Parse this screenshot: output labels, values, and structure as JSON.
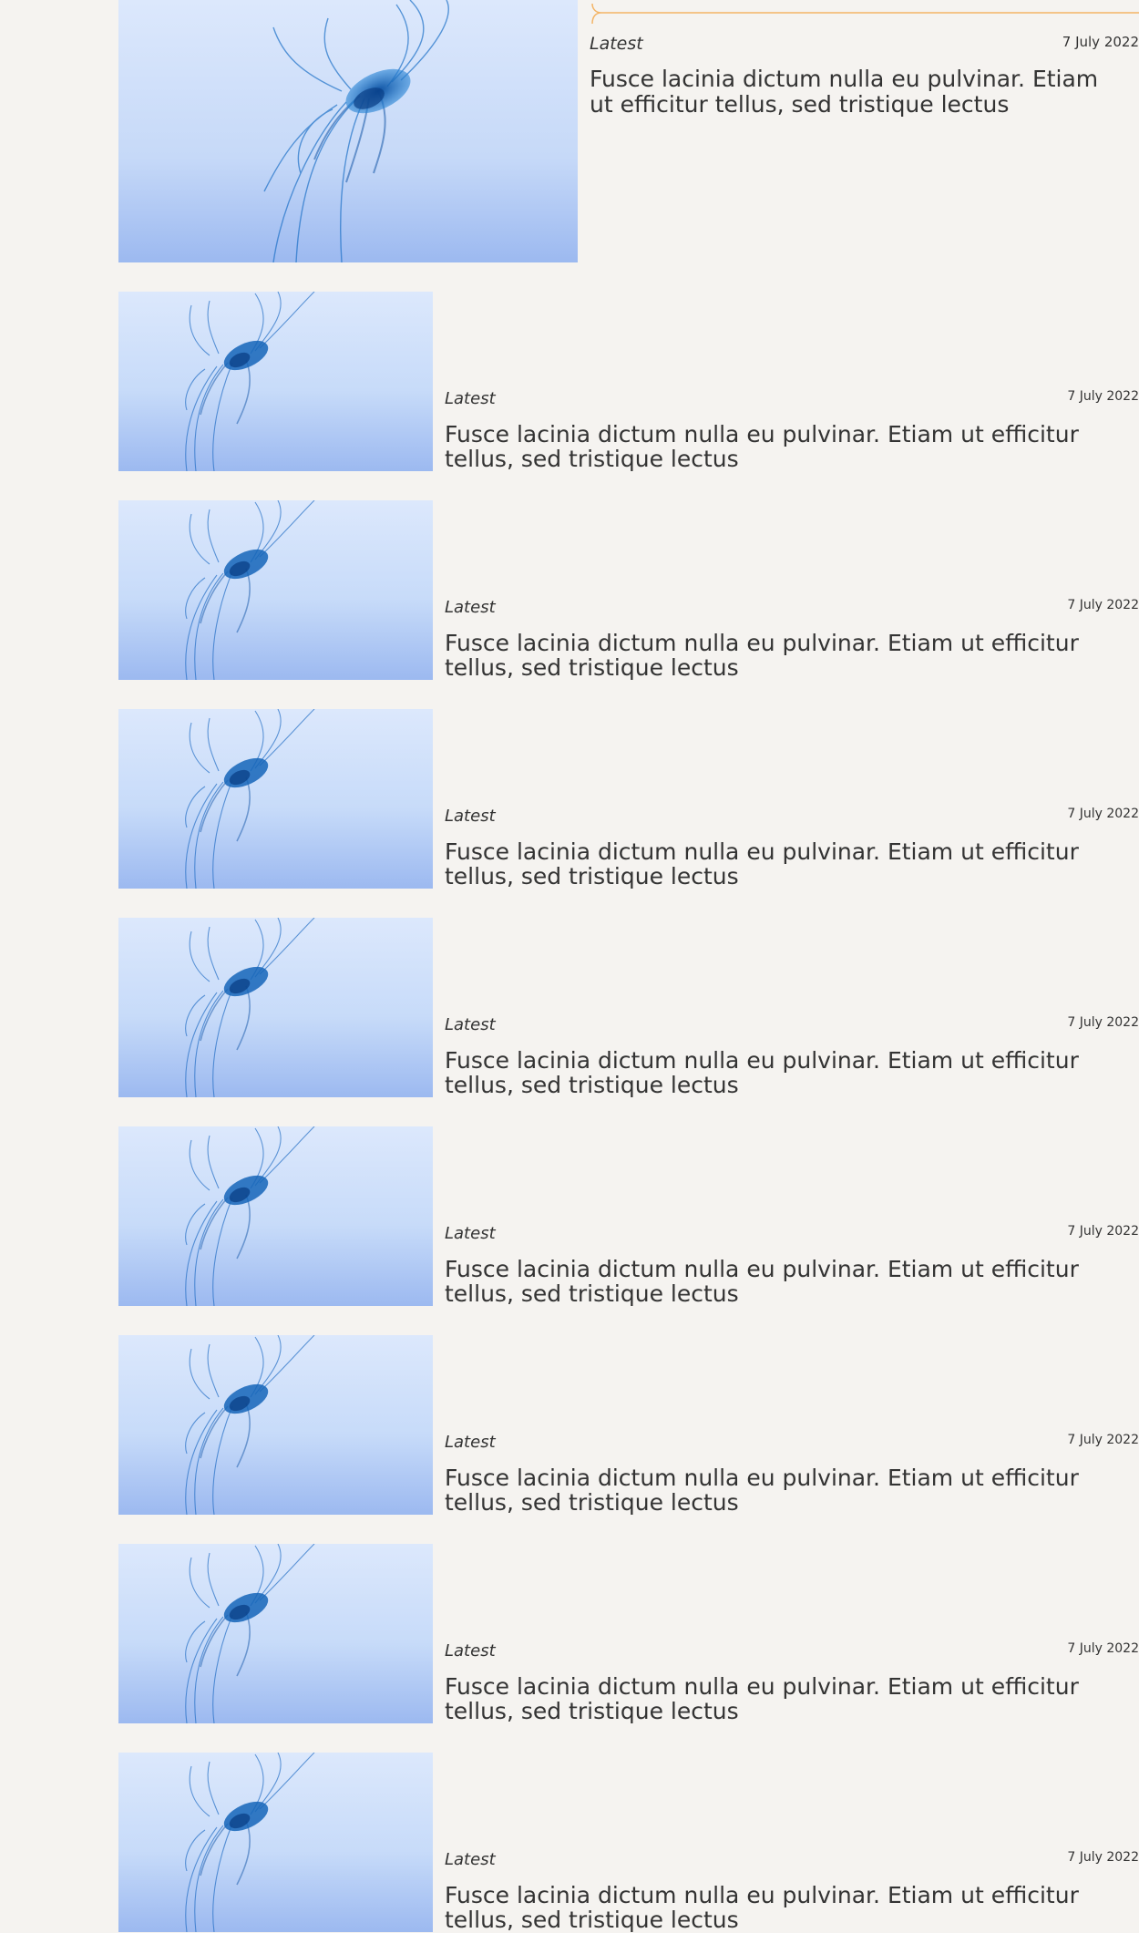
{
  "featured": {
    "tag": "Latest",
    "date": "7 July 2022",
    "title": "Fusce lacinia dictum nulla eu pulvinar. Etiam ut efficitur tellus, sed tristique lectus",
    "image_icon": "jellyfish-photo",
    "accent_color": "#f3b466"
  },
  "posts": [
    {
      "tag": "Latest",
      "date": "7 July 2022",
      "title": "Fusce lacinia dictum nulla eu pulvinar. Etiam ut efficitur tellus, sed tristique lectus"
    },
    {
      "tag": "Latest",
      "date": "7 July 2022",
      "title": "Fusce lacinia dictum nulla eu pulvinar. Etiam ut efficitur tellus, sed tristique lectus"
    },
    {
      "tag": "Latest",
      "date": "7 July 2022",
      "title": "Fusce lacinia dictum nulla eu pulvinar. Etiam ut efficitur tellus, sed tristique lectus"
    },
    {
      "tag": "Latest",
      "date": "7 July 2022",
      "title": "Fusce lacinia dictum nulla eu pulvinar. Etiam ut efficitur tellus, sed tristique lectus"
    },
    {
      "tag": "Latest",
      "date": "7 July 2022",
      "title": "Fusce lacinia dictum nulla eu pulvinar. Etiam ut efficitur tellus, sed tristique lectus"
    },
    {
      "tag": "Latest",
      "date": "7 July 2022",
      "title": "Fusce lacinia dictum nulla eu pulvinar. Etiam ut efficitur tellus, sed tristique lectus"
    },
    {
      "tag": "Latest",
      "date": "7 July 2022",
      "title": "Fusce lacinia dictum nulla eu pulvinar. Etiam ut efficitur tellus, sed tristique lectus"
    },
    {
      "tag": "Latest",
      "date": "7 July 2022",
      "title": "Fusce lacinia dictum nulla eu pulvinar. Etiam ut efficitur tellus, sed tristique lectus"
    }
  ],
  "colors": {
    "background": "#f5f3f0",
    "text": "#333333",
    "image_top": "#dce8fc",
    "image_bottom": "#9cb9f0",
    "jellyfish": "#1a68c2"
  }
}
